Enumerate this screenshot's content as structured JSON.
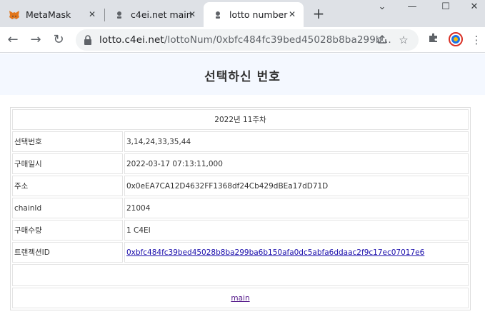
{
  "browser": {
    "tabs": [
      {
        "title": "MetaMask",
        "favicon": "metamask-fox-icon",
        "active": false
      },
      {
        "title": "c4ei.net main",
        "favicon": "page-icon",
        "active": false
      },
      {
        "title": "lotto number",
        "favicon": "page-icon",
        "active": true
      }
    ],
    "url_host": "lotto.c4ei.net",
    "url_path": "/lottoNum/0xbfc484fc39bed45028b8ba299b..."
  },
  "page": {
    "title": "선택하신 번호",
    "week": "2022년 11주차",
    "rows": [
      {
        "label": "선택번호",
        "value": "3,14,24,33,35,44"
      },
      {
        "label": "구매일시",
        "value": "2022-03-17 07:13:11,000"
      },
      {
        "label": "주소",
        "value": "0x0eEA7CA12D4632FF1368df24Cb429dBEa17dD71D"
      },
      {
        "label": "chainId",
        "value": "21004"
      },
      {
        "label": "구매수량",
        "value": "1 C4EI"
      }
    ],
    "tx_label": "트랜젝션ID",
    "tx_value": "0xbfc484fc39bed45028b8ba299ba6b150afa0dc5abfa6ddaac2f9c17ec07017e6",
    "main_link": "main"
  }
}
